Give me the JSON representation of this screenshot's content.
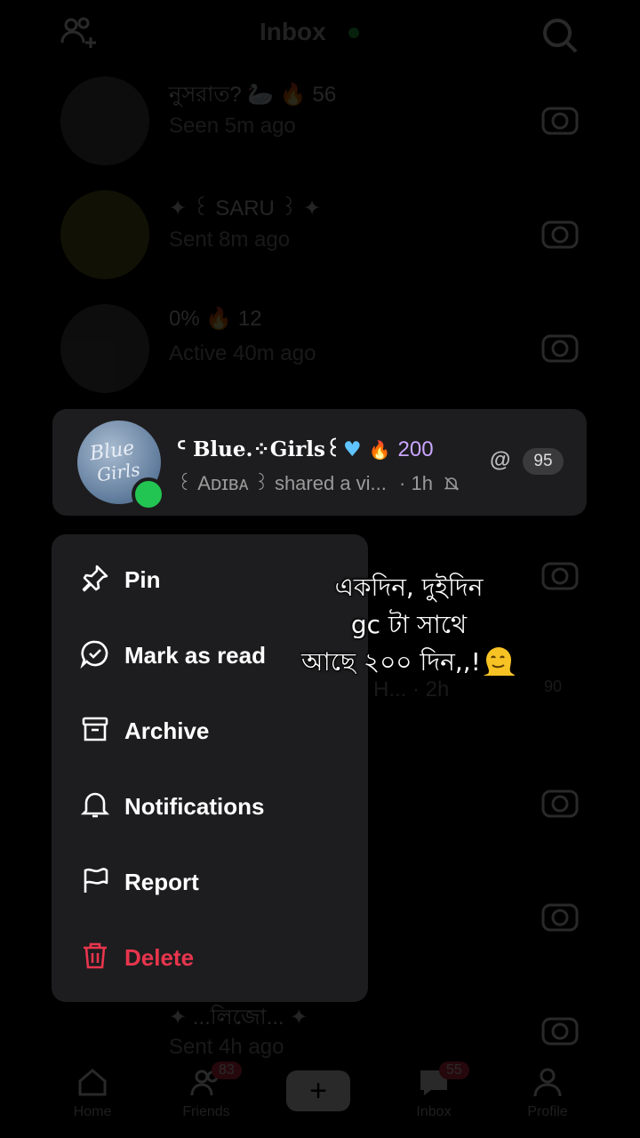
{
  "header": {
    "title": "Inbox"
  },
  "background_rows": [
    {
      "name": "নুসরাত? 🦢 🔥 56",
      "sub": "Seen 5m ago"
    },
    {
      "name": "✦ ꒰ SARU ꒱ ✦",
      "sub": "Sent 8m ago"
    },
    {
      "name": "0% 🔥 12",
      "sub": "Active 40m ago"
    },
    {
      "name": "",
      "sub": ""
    },
    {
      "name": "",
      "sub": "H... · 2h",
      "count": "90"
    },
    {
      "name": "",
      "sub": ""
    },
    {
      "name": "",
      "sub": ""
    },
    {
      "name": "✦ ...লিজো... ✦",
      "sub": "Sent 4h ago"
    }
  ],
  "focused_chat": {
    "name": "ᑦ Blue.⁘Girls꒰",
    "streak": "200",
    "subtitle": "꒰ Aᴅɪʙᴀ ꒱ shared a vi...",
    "time": "· 1h",
    "mention": "@",
    "unread_count": "95",
    "avatar_text_line1": "Blue",
    "avatar_text_line2": "Girls"
  },
  "context_menu": {
    "items": [
      {
        "label": "Pin",
        "icon": "pin-icon"
      },
      {
        "label": "Mark as read",
        "icon": "mark-read-icon"
      },
      {
        "label": "Archive",
        "icon": "archive-icon"
      },
      {
        "label": "Notifications",
        "icon": "bell-icon"
      },
      {
        "label": "Report",
        "icon": "flag-icon"
      },
      {
        "label": "Delete",
        "icon": "trash-icon"
      }
    ]
  },
  "overlay_caption": {
    "line1": "একদিন, দুইদিন",
    "line2": "gc টা সাথে",
    "line3": "আছে ২০০ দিন,,!"
  },
  "bottom_nav": {
    "home": "Home",
    "friends": "Friends",
    "friends_badge": "83",
    "inbox": "Inbox",
    "inbox_badge": "55",
    "profile": "Profile",
    "create": "+"
  },
  "colors": {
    "delete": "#e8354d",
    "online": "#23c552",
    "streak": "#c9a5ff"
  }
}
